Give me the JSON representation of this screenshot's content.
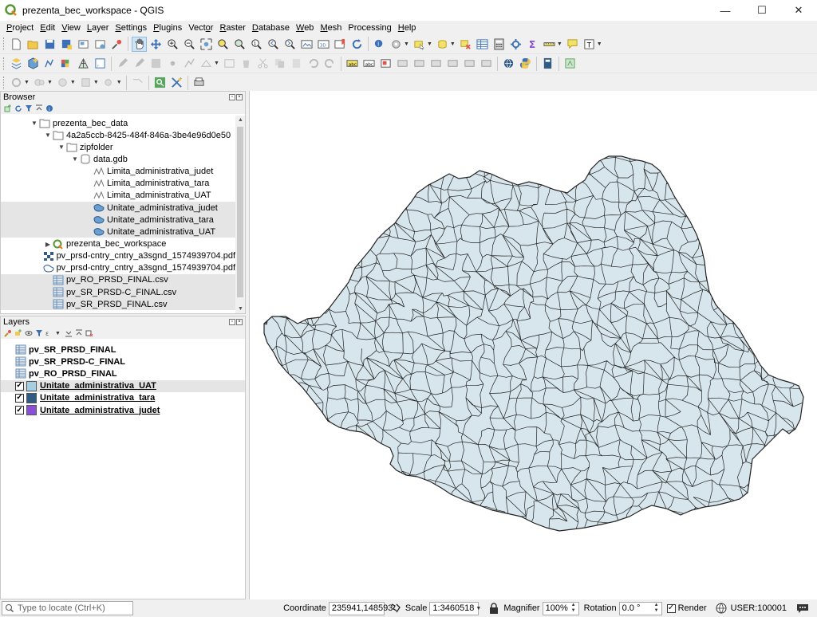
{
  "window": {
    "title": "prezenta_bec_workspace - QGIS",
    "minimize": "—",
    "maximize": "☐",
    "close": "✕"
  },
  "menu": [
    {
      "label": "Project",
      "accel": "P",
      "rest": "roject"
    },
    {
      "label": "Edit",
      "accel": "E",
      "rest": "dit"
    },
    {
      "label": "View",
      "accel": "V",
      "rest": "iew"
    },
    {
      "label": "Layer",
      "accel": "L",
      "rest": "ayer"
    },
    {
      "label": "Settings",
      "accel": "S",
      "rest": "ettings"
    },
    {
      "label": "Plugins",
      "accel": "P",
      "rest": "lugins"
    },
    {
      "label": "Vector",
      "accel": "o",
      "rest": "Vect|r"
    },
    {
      "label": "Raster",
      "accel": "R",
      "rest": "aster"
    },
    {
      "label": "Database",
      "accel": "D",
      "rest": "atabase"
    },
    {
      "label": "Web",
      "accel": "W",
      "rest": "eb"
    },
    {
      "label": "Mesh",
      "accel": "M",
      "rest": "esh"
    },
    {
      "label": "Processing",
      "accel": "",
      "rest": "Processing"
    },
    {
      "label": "Help",
      "accel": "H",
      "rest": "elp"
    }
  ],
  "browser": {
    "title": "Browser",
    "tree": [
      {
        "label": "prezenta_bec_data",
        "level": 0,
        "arrow": "▼",
        "icon": "folder-icon",
        "selected": false
      },
      {
        "label": "4a2a5ccb-8425-484f-846a-3be4e96d0e50",
        "level": 1,
        "arrow": "▼",
        "icon": "folder-icon",
        "selected": false
      },
      {
        "label": "zipfolder",
        "level": 2,
        "arrow": "▼",
        "icon": "folder-icon",
        "selected": false
      },
      {
        "label": "data.gdb",
        "level": 3,
        "arrow": "▼",
        "icon": "database-icon",
        "selected": false
      },
      {
        "label": "Limita_administrativa_judet",
        "level": 4,
        "arrow": "",
        "icon": "line-layer-icon",
        "selected": false
      },
      {
        "label": "Limita_administrativa_tara",
        "level": 4,
        "arrow": "",
        "icon": "line-layer-icon",
        "selected": false
      },
      {
        "label": "Limita_administrativa_UAT",
        "level": 4,
        "arrow": "",
        "icon": "line-layer-icon",
        "selected": false
      },
      {
        "label": "Unitate_administrativa_judet",
        "level": 4,
        "arrow": "",
        "icon": "polygon-layer-icon",
        "selected": true
      },
      {
        "label": "Unitate_administrativa_tara",
        "level": 4,
        "arrow": "",
        "icon": "polygon-layer-icon",
        "selected": true
      },
      {
        "label": "Unitate_administrativa_UAT",
        "level": 4,
        "arrow": "",
        "icon": "polygon-layer-icon",
        "selected": true
      },
      {
        "label": "prezenta_bec_workspace",
        "level": 1,
        "arrow": "▶",
        "icon": "qgis-project-icon",
        "selected": false
      },
      {
        "label": "pv_prsd-cntry_cntry_a3sgnd_1574939704.pdf",
        "level": 1,
        "arrow": "",
        "icon": "pdf-raster-icon",
        "selected": false
      },
      {
        "label": "pv_prsd-cntry_cntry_a3sgnd_1574939704.pdf",
        "level": 1,
        "arrow": "",
        "icon": "pdf-vector-icon",
        "selected": false
      },
      {
        "label": "pv_RO_PRSD_FINAL.csv",
        "level": 1,
        "arrow": "",
        "icon": "table-icon",
        "selected": true
      },
      {
        "label": "pv_SR_PRSD-C_FINAL.csv",
        "level": 1,
        "arrow": "",
        "icon": "table-icon",
        "selected": true
      },
      {
        "label": "pv_SR_PRSD_FINAL.csv",
        "level": 1,
        "arrow": "",
        "icon": "table-icon",
        "selected": true
      }
    ]
  },
  "layers": {
    "title": "Layers",
    "items": [
      {
        "label": "pv_SR_PRSD_FINAL",
        "type": "table",
        "checked": null,
        "color": "",
        "selected": false,
        "underline": false
      },
      {
        "label": "pv_SR_PRSD-C_FINAL",
        "type": "table",
        "checked": null,
        "color": "",
        "selected": false,
        "underline": false
      },
      {
        "label": "pv_RO_PRSD_FINAL",
        "type": "table",
        "checked": null,
        "color": "",
        "selected": false,
        "underline": false
      },
      {
        "label": "Unitate_administrativa_UAT",
        "type": "polygon",
        "checked": true,
        "color": "#a6cee3",
        "selected": true,
        "underline": true
      },
      {
        "label": "Unitate_administrativa_tara",
        "type": "polygon",
        "checked": true,
        "color": "#2f5b85",
        "selected": false,
        "underline": true
      },
      {
        "label": "Unitate_administrativa_judet",
        "type": "polygon",
        "checked": true,
        "color": "#8a4fd6",
        "selected": false,
        "underline": true
      }
    ]
  },
  "map": {
    "fill_color": "#d7e6ec",
    "stroke_color": "#222222"
  },
  "status": {
    "locator_placeholder": "Type to locate (Ctrl+K)",
    "coordinate_label": "Coordinate",
    "coordinate_value": "235941,148593",
    "scale_label": "Scale",
    "scale_value": "1:3460518",
    "magnifier_label": "Magnifier",
    "magnifier_value": "100%",
    "rotation_label": "Rotation",
    "rotation_value": "0.0 °",
    "render_label": "Render",
    "render_checked": true,
    "crs_label": "USER:100001"
  }
}
